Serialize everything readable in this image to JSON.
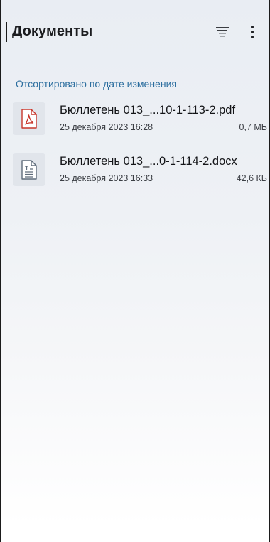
{
  "header": {
    "title": "Документы",
    "sort_icon": "sort-lines-icon",
    "more_icon": "more-vertical-icon"
  },
  "section": {
    "label": "Отсортировано по дате изменения"
  },
  "files": [
    {
      "name": "Бюллетень 013_...10-1-113-2.pdf",
      "date": "25 декабря 2023 16:28",
      "size": "0,7 МБ",
      "icon": "pdf-file-icon"
    },
    {
      "name": "Бюллетень 013_...0-1-114-2.docx",
      "date": "25 декабря 2023 16:33",
      "size": "42,6 КБ",
      "icon": "text-document-icon"
    }
  ],
  "colors": {
    "accent": "#2c6e9f",
    "pdf_red": "#c8362b",
    "doc_gray": "#5f6c7b",
    "thumb_bg": "#e1e5eb"
  }
}
